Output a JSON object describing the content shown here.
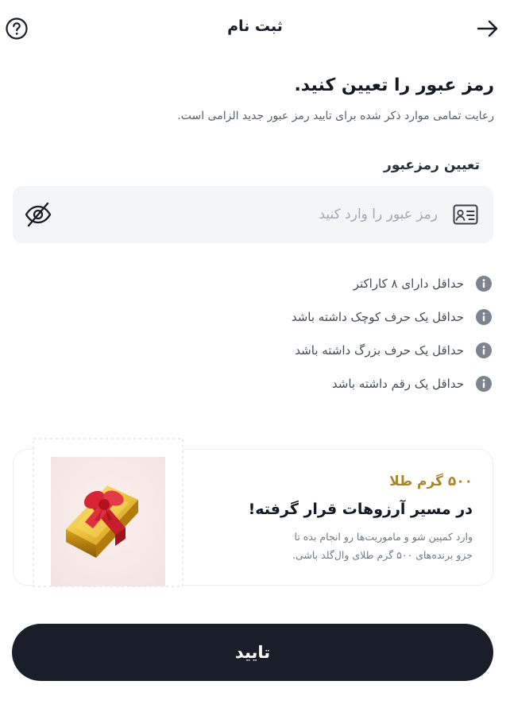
{
  "header": {
    "title": "ثبت نام",
    "back_icon": "arrow-right-icon",
    "help_icon": "question-circle-icon"
  },
  "form": {
    "heading": "رمز عبور را تعیین کنید.",
    "subheading": "رعایت تمامی موارد ذکر شده برای تایید رمز عبور جدید الزامی است.",
    "field_label": "تعیین رمزعبور",
    "password_placeholder": "رمز عبور را وارد کنید",
    "password_value": "",
    "leading_icon": "id-card-icon",
    "visibility_icon": "eye-off-icon"
  },
  "rules": [
    {
      "text": "حداقل دارای ۸ کاراکتر",
      "icon": "info-icon"
    },
    {
      "text": "حداقل یک حرف کوچک داشته باشد",
      "icon": "info-icon"
    },
    {
      "text": "حداقل یک حرف بزرگ داشته باشد",
      "icon": "info-icon"
    },
    {
      "text": "حداقل یک رقم داشته باشد",
      "icon": "info-icon"
    }
  ],
  "promo": {
    "amount": "۵۰۰ گرم طلا",
    "title": "در مسیر آرزوهات قرار گرفته!",
    "description_line1": "وارد کمپین شو و ماموریت‌ها رو انجام بده تا",
    "description_line2": "جزو برنده‌های ۵۰۰ گرم طلای وال‌گلد باشی.",
    "image": "gold-bar-gift-image"
  },
  "confirm_button": {
    "label": "تایید"
  },
  "colors": {
    "primary_dark": "#1a1e29",
    "gold_accent": "#a8872a",
    "input_bg": "#f4f5f7",
    "info_icon": "#8a8e98"
  }
}
